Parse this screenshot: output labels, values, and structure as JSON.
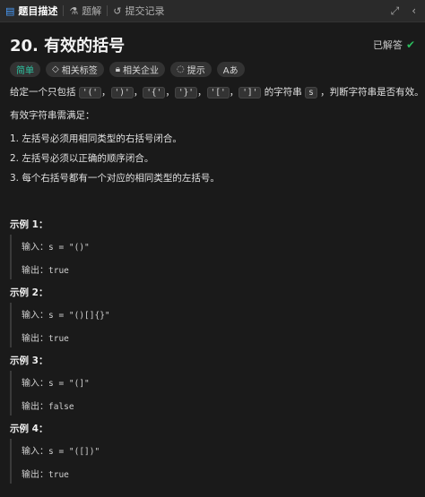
{
  "tabs": [
    {
      "label": "题目描述",
      "icon": "document-icon",
      "active": true
    },
    {
      "label": "题解",
      "icon": "flask-icon",
      "active": false
    },
    {
      "label": "提交记录",
      "icon": "history-icon",
      "active": false
    }
  ],
  "window_controls": {
    "expand": "expand-icon",
    "collapse": "collapse-icon"
  },
  "problem": {
    "title": "20. 有效的括号",
    "status": "已解答",
    "tags": [
      {
        "label": "简单",
        "kind": "difficulty"
      },
      {
        "label": "相关标签",
        "icon": "tag-icon"
      },
      {
        "label": "相关企业",
        "icon": "lock-icon"
      },
      {
        "label": "提示",
        "icon": "lightbulb-icon"
      },
      {
        "label": "Aあ",
        "icon": "translate-icon"
      }
    ]
  },
  "description": {
    "intro_prefix": "给定一个只包括 ",
    "chars": [
      "'('",
      "')'",
      "'{'",
      "'}'",
      "'['",
      "']'"
    ],
    "intro_mid": " 的字符串 ",
    "var": "s",
    "intro_suffix": " ，判断字符串是否有效。",
    "valid_title": "有效字符串需满足：",
    "rules": [
      "1. 左括号必须用相同类型的右括号闭合。",
      "2. 左括号必须以正确的顺序闭合。",
      "3. 每个右括号都有一个对应的相同类型的左括号。"
    ]
  },
  "examples": [
    {
      "title": "示例 1：",
      "input_label": "输入：",
      "input": "s = \"()\"",
      "output_label": "输出：",
      "output": "true"
    },
    {
      "title": "示例 2：",
      "input_label": "输入：",
      "input": "s = \"()[]{}\"",
      "output_label": "输出：",
      "output": "true"
    },
    {
      "title": "示例 3：",
      "input_label": "输入：",
      "input": "s = \"(]\"",
      "output_label": "输出：",
      "output": "false"
    },
    {
      "title": "示例 4：",
      "input_label": "输入：",
      "input": "s = \"([])\"",
      "output_label": "输出：",
      "output": "true"
    }
  ]
}
